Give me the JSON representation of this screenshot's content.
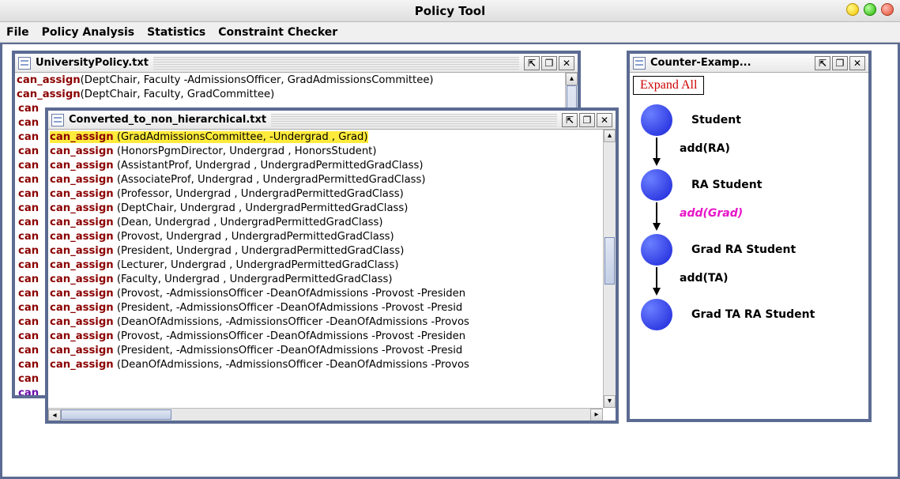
{
  "app": {
    "title": "Policy Tool"
  },
  "menu": {
    "items": [
      "File",
      "Policy Analysis",
      "Statistics",
      "Constraint Checker"
    ]
  },
  "windows": {
    "university": {
      "title": "UniversityPolicy.txt",
      "visible_lines": [
        {
          "kw": "can_assign",
          "args": "(DeptChair, Faculty -AdmissionsOfficer, GradAdmissionsCommittee)"
        },
        {
          "kw": "can_assign",
          "args": "(DeptChair, Faculty, GradCommittee)"
        }
      ],
      "left_slice_rows": 21,
      "left_slice_last_purple": true
    },
    "converted": {
      "title": "Converted_to_non_hierarchical.txt",
      "lines": [
        {
          "kw": "can_assign",
          "args": " (GradAdmissionsCommittee, -Undergrad , Grad)",
          "highlight": true
        },
        {
          "kw": "can_assign",
          "args": " (HonorsPgmDirector, Undergrad , HonorsStudent)"
        },
        {
          "kw": "can_assign",
          "args": " (AssistantProf, Undergrad , UndergradPermittedGradClass)"
        },
        {
          "kw": "can_assign",
          "args": " (AssociateProf, Undergrad , UndergradPermittedGradClass)"
        },
        {
          "kw": "can_assign",
          "args": " (Professor, Undergrad , UndergradPermittedGradClass)"
        },
        {
          "kw": "can_assign",
          "args": " (DeptChair, Undergrad , UndergradPermittedGradClass)"
        },
        {
          "kw": "can_assign",
          "args": " (Dean, Undergrad , UndergradPermittedGradClass)"
        },
        {
          "kw": "can_assign",
          "args": " (Provost, Undergrad , UndergradPermittedGradClass)"
        },
        {
          "kw": "can_assign",
          "args": " (President, Undergrad , UndergradPermittedGradClass)"
        },
        {
          "kw": "can_assign",
          "args": " (Lecturer, Undergrad , UndergradPermittedGradClass)"
        },
        {
          "kw": "can_assign",
          "args": " (Faculty, Undergrad , UndergradPermittedGradClass)"
        },
        {
          "kw": "can_assign",
          "args": " (Provost, -AdmissionsOfficer -DeanOfAdmissions -Provost -Presiden"
        },
        {
          "kw": "can_assign",
          "args": " (President, -AdmissionsOfficer -DeanOfAdmissions -Provost -Presid"
        },
        {
          "kw": "can_assign",
          "args": " (DeanOfAdmissions, -AdmissionsOfficer -DeanOfAdmissions -Provos"
        },
        {
          "kw": "can_assign",
          "args": " (Provost, -AdmissionsOfficer -DeanOfAdmissions -Provost -Presiden"
        },
        {
          "kw": "can_assign",
          "args": " (President, -AdmissionsOfficer -DeanOfAdmissions -Provost -Presid"
        },
        {
          "kw": "can_assign",
          "args": " (DeanOfAdmissions, -AdmissionsOfficer -DeanOfAdmissions -Provos"
        }
      ]
    },
    "counter": {
      "title": "Counter-Examp...",
      "expand_label": "Expand All",
      "nodes": [
        {
          "label": "Student"
        },
        {
          "label": "RA Student"
        },
        {
          "label": "Grad RA Student"
        },
        {
          "label": "Grad TA RA Student"
        }
      ],
      "edges": [
        {
          "label": "add(RA)",
          "highlight": false
        },
        {
          "label": "add(Grad)",
          "highlight": true
        },
        {
          "label": "add(TA)",
          "highlight": false
        }
      ]
    }
  },
  "window_buttons": {
    "minimize": "⇱",
    "maximize": "❐",
    "close": "✕"
  },
  "scroll_arrows": {
    "up": "▴",
    "down": "▾",
    "left": "◂",
    "right": "▸"
  }
}
